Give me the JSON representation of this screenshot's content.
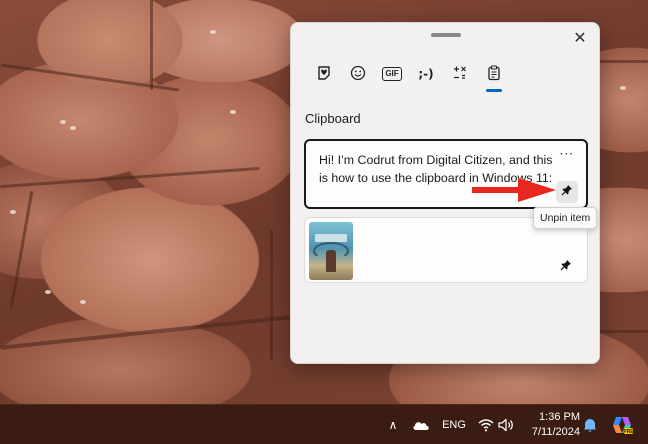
{
  "panel": {
    "tabs": [
      {
        "name": "emoji-stickers",
        "icon": "heart-sticker-icon"
      },
      {
        "name": "emoji",
        "icon": "smiley-icon"
      },
      {
        "name": "gif",
        "icon": "gif-icon",
        "label": "GIF"
      },
      {
        "name": "kaomoji",
        "icon": "kaomoji-icon",
        "label": ";-)"
      },
      {
        "name": "symbols",
        "icon": "symbols-icon"
      },
      {
        "name": "clipboard",
        "icon": "clipboard-icon",
        "active": true
      }
    ],
    "section_title": "Clipboard",
    "items": [
      {
        "text": "Hi! I’m Codrut from Digital Citizen, and this is how to use the clipboard in Windows 11:",
        "more_label": "···",
        "pinned": true
      },
      {
        "type": "image",
        "pinned": true
      }
    ],
    "tooltip": "Unpin item",
    "close_label": "✕"
  },
  "taskbar": {
    "language": "ENG",
    "time": "1:36 PM",
    "date": "7/11/2024",
    "chevron": "∧"
  },
  "colors": {
    "accent": "#0067c0",
    "arrow": "#e8281e",
    "taskbar": "#3a1c12"
  }
}
